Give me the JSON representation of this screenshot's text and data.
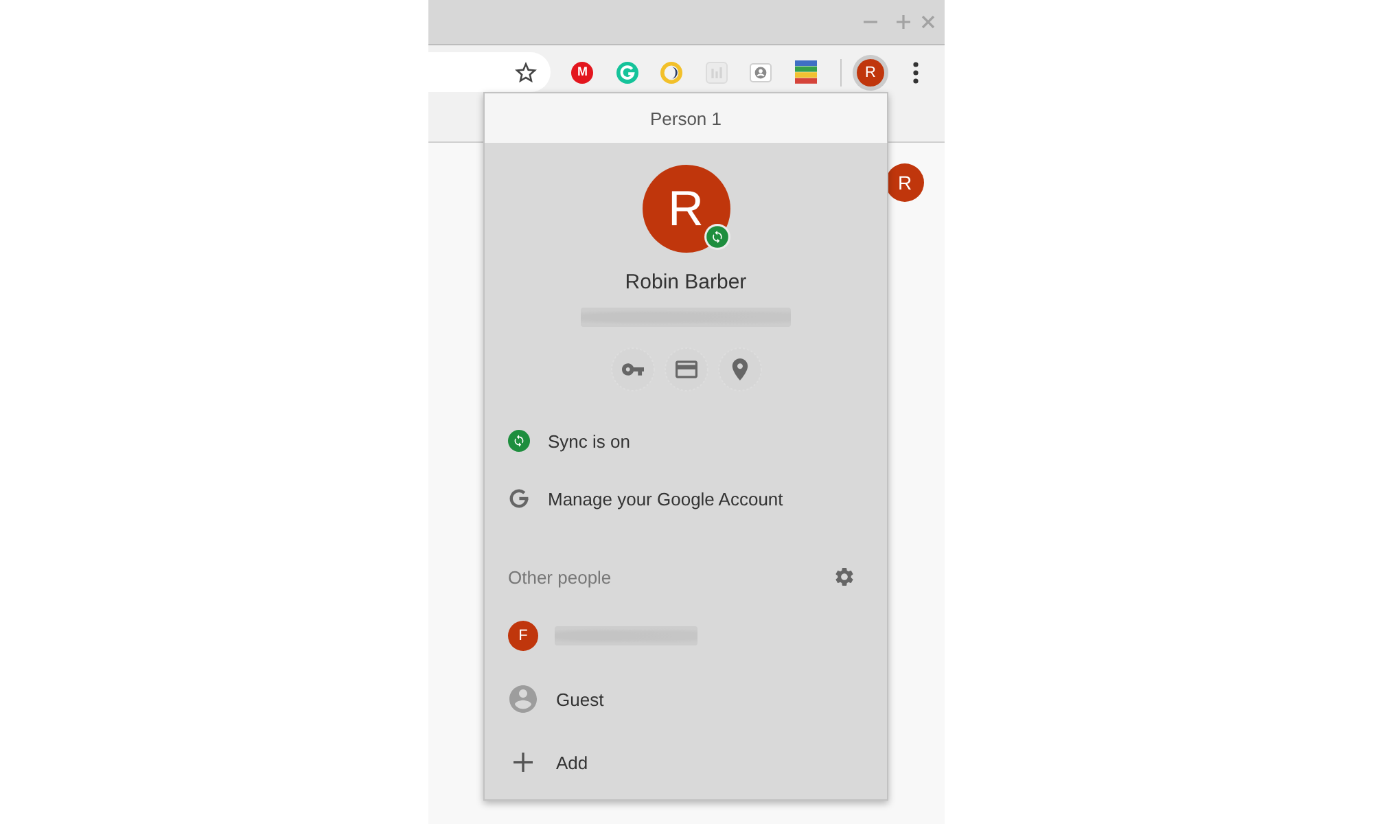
{
  "toolbar": {
    "extensions": [
      {
        "kind": "letter",
        "glyph": "M"
      },
      {
        "kind": "circle-arrow"
      },
      {
        "kind": "ring"
      },
      {
        "kind": "chart"
      },
      {
        "kind": "contact"
      },
      {
        "kind": "stripes"
      }
    ],
    "profile_initial": "R"
  },
  "page": {
    "avatar_initial": "R"
  },
  "profile_menu": {
    "header": "Person 1",
    "avatar_initial": "R",
    "name": "Robin Barber",
    "items": [
      {
        "kind": "sync",
        "label": "Sync is on"
      },
      {
        "kind": "account",
        "label": "Manage your Google Account"
      }
    ],
    "other_people": {
      "title": "Other people",
      "entries": [
        {
          "kind": "profile",
          "initial": "F"
        },
        {
          "kind": "guest",
          "label": "Guest"
        },
        {
          "kind": "add",
          "label": "Add"
        }
      ]
    }
  }
}
